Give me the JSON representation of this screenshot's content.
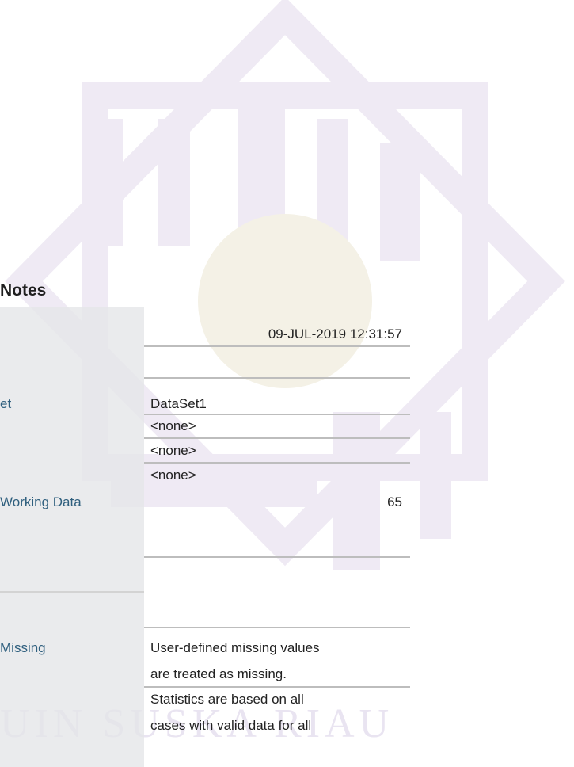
{
  "title": "Notes",
  "rows": {
    "created": {
      "value": "09-JUL-2019 12:31:57"
    },
    "active_dataset": {
      "label": "et",
      "value": "DataSet1"
    },
    "filter": {
      "value": "<none>"
    },
    "weight": {
      "value": "<none>"
    },
    "split_file": {
      "value": "<none>"
    },
    "n_rows": {
      "label": "Working Data",
      "value": "65"
    },
    "missing_def": {
      "label": "Missing",
      "value_line1": "User-defined missing values",
      "value_line2": "are treated as missing."
    },
    "cases_used": {
      "value_line1": "Statistics are based on all",
      "value_line2": "cases with valid data for all"
    }
  },
  "watermark": {
    "text": "UIN SUSKA RIAU"
  }
}
